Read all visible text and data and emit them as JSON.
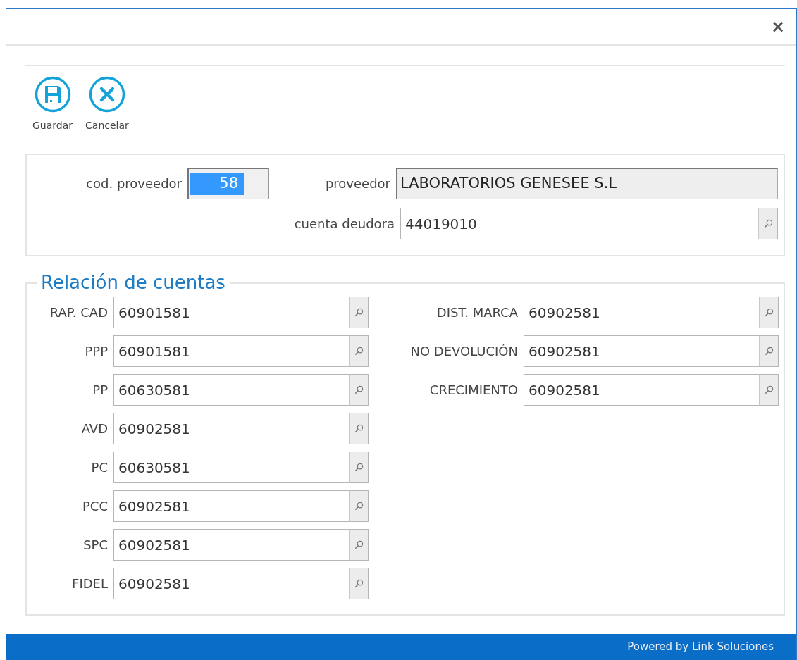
{
  "window": {
    "close": "×"
  },
  "toolbar": [
    {
      "kind": "save",
      "label": "Guardar"
    },
    {
      "kind": "cancel",
      "label": "Cancelar"
    }
  ],
  "supplier": {
    "code_label": "cod. proveedor",
    "code": "58",
    "code_selected": true,
    "name_label": "proveedor",
    "name": "LABORATORIOS GENESEE S.L",
    "name_readonly": true,
    "account_label": "cuenta deudora",
    "account": "44019010"
  },
  "accounts": {
    "title": "Relación de cuentas",
    "left": [
      {
        "label": "RAP. CAD",
        "value": "60901581"
      },
      {
        "label": "PPP",
        "value": "60901581"
      },
      {
        "label": "PP",
        "value": "60630581"
      },
      {
        "label": "AVD",
        "value": "60902581"
      },
      {
        "label": "PC",
        "value": "60630581"
      },
      {
        "label": "PCC",
        "value": "60902581"
      },
      {
        "label": "SPC",
        "value": "60902581"
      },
      {
        "label": "FIDEL",
        "value": "60902581"
      }
    ],
    "right": [
      {
        "label": "DIST. MARCA",
        "value": "60902581"
      },
      {
        "label": "NO DEVOLUCIÓN",
        "value": "60902581"
      },
      {
        "label": "CRECIMIENTO",
        "value": "60902581"
      }
    ]
  },
  "status_bar": "Powered by Link Soluciones"
}
